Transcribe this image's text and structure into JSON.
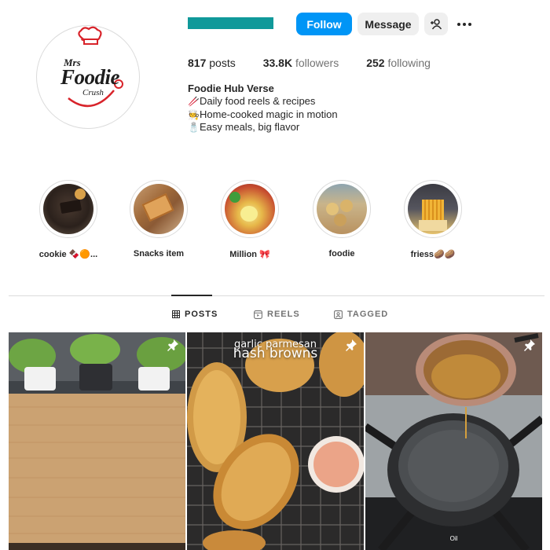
{
  "profile": {
    "logo": {
      "line1": "Mrs",
      "line2": "Foodie",
      "line3": "Crush"
    },
    "buttons": {
      "follow": "Follow",
      "message": "Message"
    },
    "stats": {
      "posts": {
        "value": "817",
        "label": "posts"
      },
      "followers": {
        "value": "33.8K",
        "label": "followers"
      },
      "following": {
        "value": "252",
        "label": "following"
      }
    },
    "bio": {
      "name": "Foodie Hub Verse",
      "lines": [
        {
          "emoji": "🥢",
          "text": "Daily food reels & recipes"
        },
        {
          "emoji": "🧑‍🍳",
          "text": "Home-cooked magic in motion"
        },
        {
          "emoji": "🧂",
          "text": "Easy meals, big flavor"
        }
      ]
    }
  },
  "highlights": [
    {
      "label": "cookie 🍫🟠..."
    },
    {
      "label": "Snacks item"
    },
    {
      "label": "Million 🎀"
    },
    {
      "label": "foodie"
    },
    {
      "label": "friess🥔🥔"
    }
  ],
  "tabs": [
    {
      "label": "POSTS",
      "active": true
    },
    {
      "label": "REELS",
      "active": false
    },
    {
      "label": "TAGGED",
      "active": false
    }
  ],
  "posts": [
    {
      "overlay": ""
    },
    {
      "overlay_line1": "garlic parmesan",
      "overlay_line2": "hash browns"
    },
    {
      "overlay": "Oil"
    }
  ],
  "colors": {
    "accent": "#0095f6",
    "username_redacted": "#10999a",
    "logo_red": "#d8232a"
  }
}
